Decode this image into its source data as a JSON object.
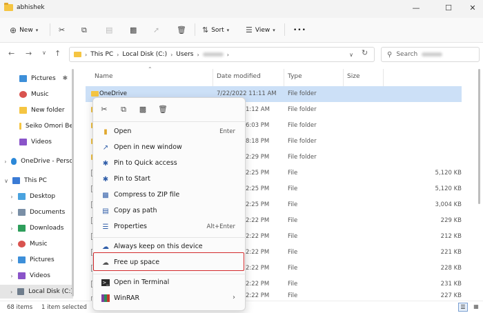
{
  "window": {
    "title": "abhishek"
  },
  "toolbar": {
    "new_label": "New",
    "sort_label": "Sort",
    "view_label": "View",
    "more": "•••"
  },
  "address": {
    "this_pc": "This PC",
    "disk": "Local Disk (C:)",
    "users": "Users",
    "search_placeholder": "Search"
  },
  "sidebar": {
    "items": [
      {
        "label": "Pictures",
        "pinned": true
      },
      {
        "label": "Music"
      },
      {
        "label": "New folder"
      },
      {
        "label": "Seiko Omori Be"
      },
      {
        "label": "Videos"
      },
      {
        "label": "OneDrive - Perso"
      },
      {
        "label": "This PC"
      },
      {
        "label": "Desktop"
      },
      {
        "label": "Documents"
      },
      {
        "label": "Downloads"
      },
      {
        "label": "Music"
      },
      {
        "label": "Pictures"
      },
      {
        "label": "Videos"
      },
      {
        "label": "Local Disk (C:)"
      }
    ]
  },
  "columns": {
    "name": "Name",
    "date": "Date modified",
    "type": "Type",
    "size": "Size"
  },
  "rows": [
    {
      "name": "OneDrive",
      "date": "7/22/2022 11:11 AM",
      "type": "File folder",
      "size": ""
    },
    {
      "name": "",
      "date": "1:12 AM",
      "type": "File folder",
      "size": ""
    },
    {
      "name": "",
      "date": "6:03 PM",
      "type": "File folder",
      "size": ""
    },
    {
      "name": "",
      "date": "8:18 PM",
      "type": "File folder",
      "size": ""
    },
    {
      "name": "",
      "date": "2:29 PM",
      "type": "File folder",
      "size": ""
    },
    {
      "name": "",
      "date": "2:25 PM",
      "type": "File",
      "size": "5,120 KB"
    },
    {
      "name": "",
      "date": "2:25 PM",
      "type": "File",
      "size": "5,120 KB"
    },
    {
      "name": "",
      "date": "2:25 PM",
      "type": "File",
      "size": "3,004 KB"
    },
    {
      "name": "",
      "date": "2:22 PM",
      "type": "File",
      "size": "229 KB"
    },
    {
      "name": "",
      "date": "2:22 PM",
      "type": "File",
      "size": "212 KB"
    },
    {
      "name": "",
      "date": "2:22 PM",
      "type": "File",
      "size": "221 KB"
    },
    {
      "name": "",
      "date": "2:22 PM",
      "type": "File",
      "size": "228 KB"
    },
    {
      "name": "",
      "date": "2:22 PM",
      "type": "File",
      "size": "231 KB"
    },
    {
      "name": "",
      "date": "2:22 PM",
      "type": "File",
      "size": "227 KB"
    }
  ],
  "context_menu": {
    "items": [
      {
        "label": "Open",
        "shortcut": "Enter"
      },
      {
        "label": "Open in new window",
        "shortcut": ""
      },
      {
        "label": "Pin to Quick access",
        "shortcut": ""
      },
      {
        "label": "Pin to Start",
        "shortcut": ""
      },
      {
        "label": "Compress to ZIP file",
        "shortcut": ""
      },
      {
        "label": "Copy as path",
        "shortcut": ""
      },
      {
        "label": "Properties",
        "shortcut": "Alt+Enter"
      },
      {
        "label": "Always keep on this device",
        "shortcut": ""
      },
      {
        "label": "Free up space",
        "shortcut": ""
      },
      {
        "label": "Open in Terminal",
        "shortcut": ""
      },
      {
        "label": "WinRAR",
        "shortcut": ""
      }
    ]
  },
  "status": {
    "count": "68 items",
    "selected": "1 item selected"
  },
  "colors": {
    "accent": "#0067c0",
    "highlight": "#d2292b",
    "selection": "#cce0f7",
    "folder": "#f5c542"
  }
}
